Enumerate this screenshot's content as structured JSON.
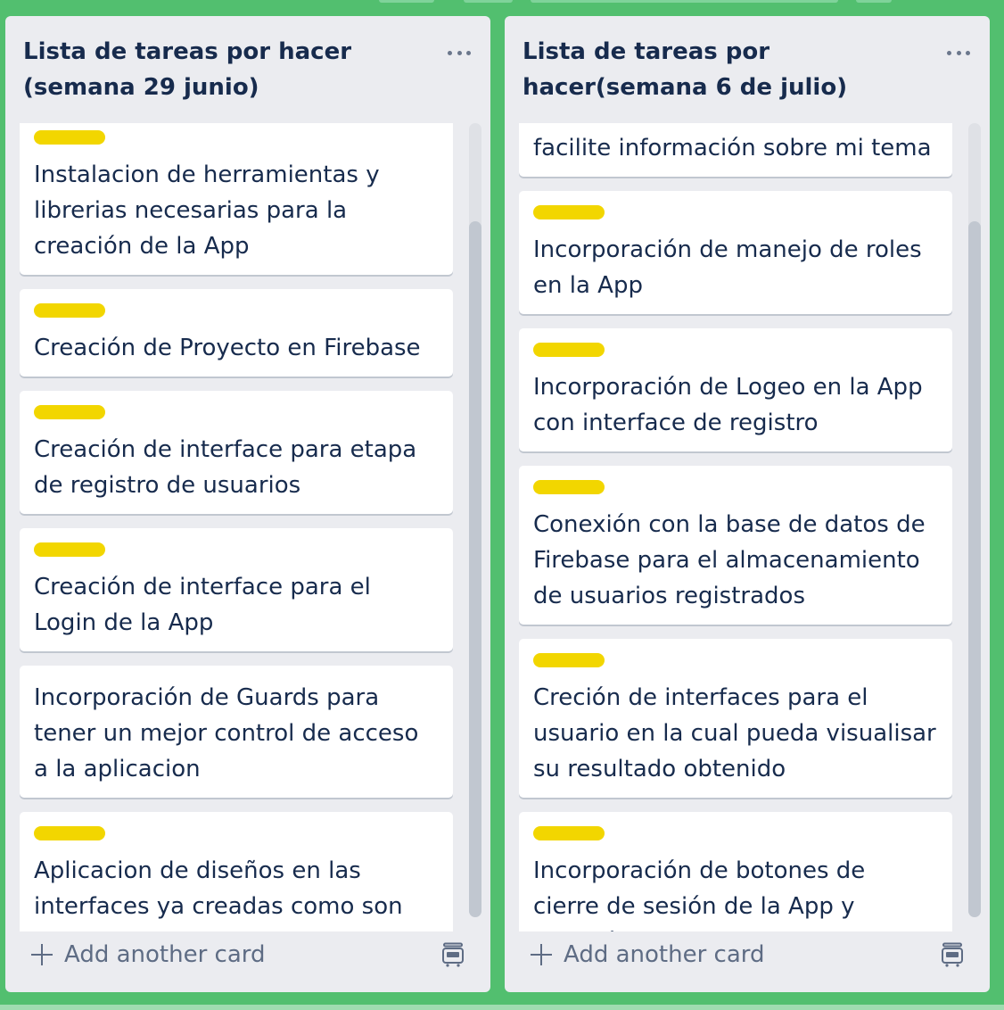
{
  "board": {
    "lists": [
      {
        "title": "Lista de tareas por hacer (semana 29 junio)",
        "add_card_label": "Add another card",
        "cards": [
          {
            "has_label": true,
            "text": "Instalacion de herramientas y librerias necesarias para la creación de la App"
          },
          {
            "has_label": true,
            "text": "Creación de Proyecto en Firebase"
          },
          {
            "has_label": true,
            "text": "Creación de interface para etapa de registro de usuarios"
          },
          {
            "has_label": true,
            "text": "Creación de interface para el Login de la App"
          },
          {
            "has_label": false,
            "text": "Incorporación de Guards para tener un mejor control de acceso a la aplicacion"
          },
          {
            "has_label": true,
            "text": "Aplicacion de diseños en las interfaces ya creadas como son Login y Registro de usuarios"
          }
        ]
      },
      {
        "title": "Lista de tareas por hacer(semana 6 de julio)",
        "add_card_label": "Add another card",
        "cards": [
          {
            "has_label": false,
            "text": "facilite información sobre mi tema"
          },
          {
            "has_label": true,
            "text": "Incorporación de manejo de roles en la App"
          },
          {
            "has_label": true,
            "text": "Incorporación de Logeo en la App con interface de registro"
          },
          {
            "has_label": true,
            "text": "Conexión con la base de datos de Firebase para el almacenamiento de usuarios registrados"
          },
          {
            "has_label": true,
            "text": "Creción de interfaces para el usuario en la cual pueda visualisar su resultado obtenido"
          },
          {
            "has_label": true,
            "text": "Incorporación de botones de cierre de sesión de la App y creación botones informativos"
          }
        ]
      }
    ]
  },
  "colors": {
    "board_background": "#52bf6f",
    "list_background": "#ebecf0",
    "label_yellow": "#f2d600",
    "text_primary": "#172b4d",
    "text_muted": "#5e6c84"
  },
  "icons": {
    "list_menu": "more-horizontal-icon",
    "add": "plus-icon",
    "template": "card-template-icon"
  }
}
